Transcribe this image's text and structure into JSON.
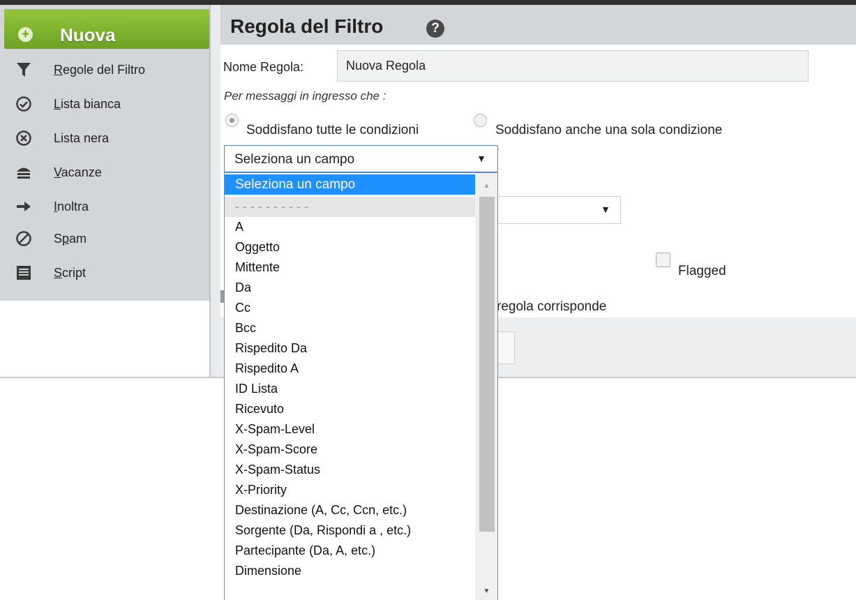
{
  "sidebar": {
    "new_button": "Nuova",
    "items": [
      {
        "icon": "funnel-icon",
        "label": "Regole del Filtro",
        "accesskey": "R"
      },
      {
        "icon": "check-circle-icon",
        "label": "Lista bianca",
        "accesskey": "L"
      },
      {
        "icon": "x-circle-icon",
        "label": "Lista nera",
        "accesskey": ""
      },
      {
        "icon": "beach-icon",
        "label": "Vacanze",
        "accesskey": "V"
      },
      {
        "icon": "arrow-right-icon",
        "label": "Inoltra",
        "accesskey": "I"
      },
      {
        "icon": "prohibited-icon",
        "label": "Spam",
        "accesskey": "p"
      },
      {
        "icon": "script-icon",
        "label": "Script",
        "accesskey": "S"
      }
    ]
  },
  "header": {
    "title": "Regola del Filtro",
    "help": "?"
  },
  "form": {
    "name_label": "Nome Regola:",
    "name_value": "Nuova Regola",
    "subtitle": "Per messaggi in ingresso che :",
    "radio_all": "Soddisfano tutte le condizioni",
    "radio_any": "Soddisfano anche una sola condizione",
    "select_value": "Seleziona un campo",
    "flagged_label": "Flagged",
    "partial_text": "regola corrisponde"
  },
  "dropdown": {
    "selected": "Seleziona un campo",
    "separator": "- - - - - - - - - -",
    "options": [
      "A",
      "Oggetto",
      "Mittente",
      "Da",
      "Cc",
      "Bcc",
      "Rispedito Da",
      "Rispedito A",
      "ID Lista",
      "Ricevuto",
      "X-Spam-Level",
      "X-Spam-Score",
      "X-Spam-Status",
      "X-Priority",
      "Destinazione (A, Cc, Ccn, etc.)",
      "Sorgente (Da, Rispondi a , etc.)",
      "Partecipante (Da, A, etc.)",
      "Dimensione"
    ]
  }
}
